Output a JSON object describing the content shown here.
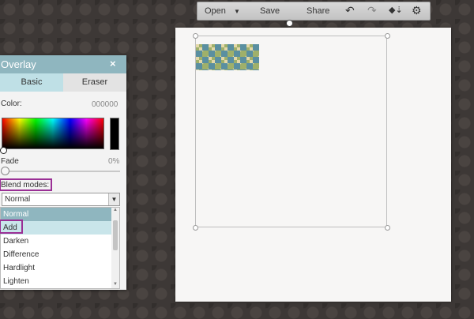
{
  "toolbar": {
    "open_label": "Open",
    "save_label": "Save",
    "share_label": "Share",
    "undo_icon": "undo-icon",
    "redo_icon": "redo-icon",
    "layers_icon": "layers-icon",
    "settings_icon": "gear-icon"
  },
  "panel": {
    "title": "Overlay",
    "close": "×",
    "tabs": [
      {
        "label": "Basic",
        "active": true
      },
      {
        "label": "Eraser",
        "active": false
      }
    ],
    "color_label": "Color:",
    "color_value": "000000",
    "fade_label": "Fade",
    "fade_value": "0%",
    "blend_label": "Blend modes:",
    "blend_selected": "Normal",
    "blend_options": [
      "Normal",
      "Add",
      "Darken",
      "Difference",
      "Hardlight",
      "Lighten"
    ],
    "swatch_color": "#000000",
    "header_color": "#8fb6bf",
    "highlight_color": "#9a2f95"
  }
}
